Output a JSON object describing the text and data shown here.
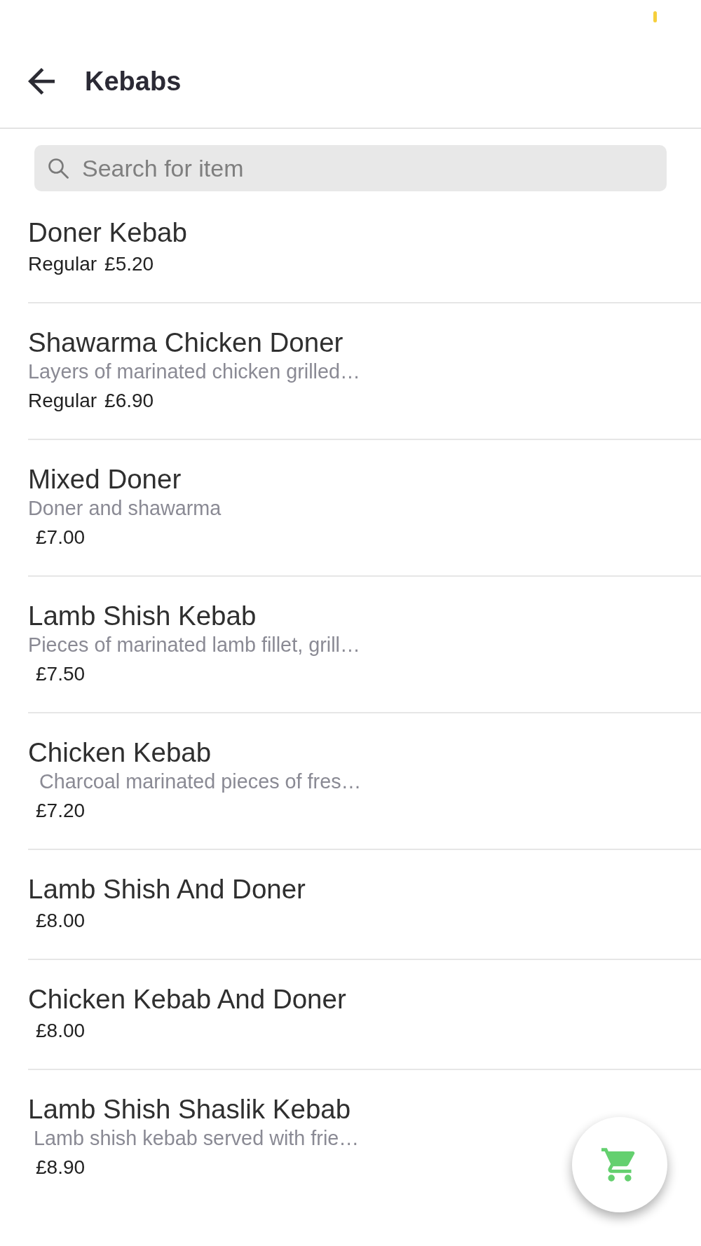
{
  "header": {
    "title": "Kebabs"
  },
  "search": {
    "placeholder": "Search for item"
  },
  "items": [
    {
      "name": "Doner Kebab",
      "size": "Regular",
      "price": "£5.20"
    },
    {
      "name": "Shawarma Chicken Doner",
      "description": "Layers of marinated chicken grilled…",
      "size": "Regular",
      "price": "£6.90"
    },
    {
      "name": "Mixed Doner",
      "description": "Doner and shawarma",
      "price": "£7.00"
    },
    {
      "name": "Lamb Shish Kebab",
      "description": "Pieces of marinated lamb fillet, grill…",
      "price": "£7.50"
    },
    {
      "name": "Chicken Kebab",
      "description": "  Charcoal marinated pieces of fres…",
      "price": "£7.20"
    },
    {
      "name": "Lamb Shish And Doner",
      "price": "£8.00"
    },
    {
      "name": "Chicken Kebab And Doner",
      "price": "£8.00"
    },
    {
      "name": "Lamb Shish Shaslik Kebab",
      "description": " Lamb shish kebab served with frie…",
      "price": "£8.90"
    }
  ]
}
